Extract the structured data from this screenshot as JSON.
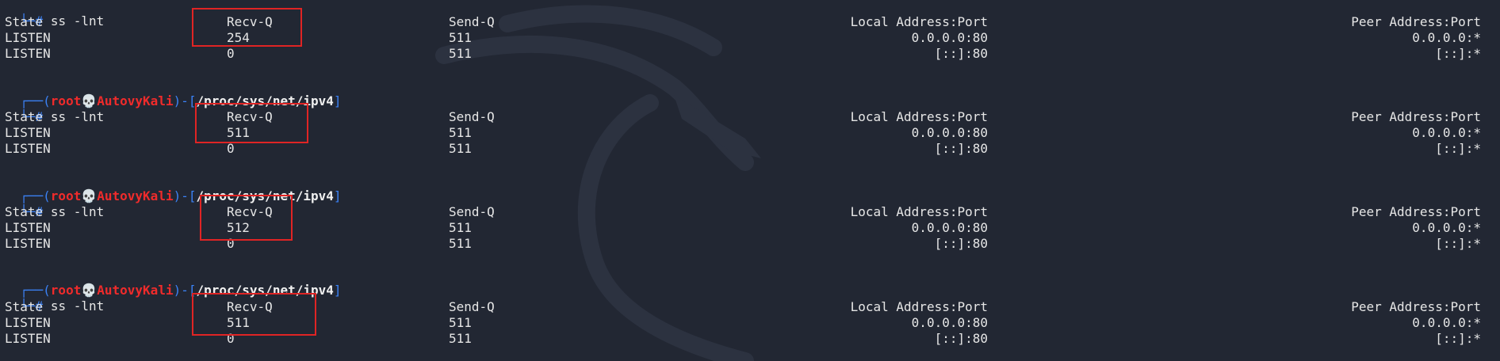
{
  "colors": {
    "background": "#222733",
    "prompt": "#3b82f6",
    "user": "#ef2b2b",
    "highlight": "#e02424"
  },
  "prompt": {
    "open": "┌──(",
    "user": "root",
    "skull": "💀",
    "host": "AutovyKali",
    "mid": ")-[",
    "path": "/proc/sys/net/ipv4",
    "close": "]",
    "hash_prefix": "└─",
    "hash": "#"
  },
  "blocks": [
    {
      "command": "ss -lnt",
      "header": {
        "state": "State",
        "recv": "Recv-Q",
        "send": "Send-Q",
        "local": "Local Address:Port",
        "peer": "Peer Address:Port"
      },
      "rows": [
        {
          "state": "LISTEN",
          "recv": "254",
          "send": "511",
          "local": "0.0.0.0:80",
          "peer": "0.0.0.0:*"
        },
        {
          "state": "LISTEN",
          "recv": "0",
          "send": "511",
          "local": "[::]:80",
          "peer": "[::]:*"
        }
      ]
    },
    {
      "command": "ss -lnt",
      "header": {
        "state": "State",
        "recv": "Recv-Q",
        "send": "Send-Q",
        "local": "Local Address:Port",
        "peer": "Peer Address:Port"
      },
      "rows": [
        {
          "state": "LISTEN",
          "recv": "511",
          "send": "511",
          "local": "0.0.0.0:80",
          "peer": "0.0.0.0:*"
        },
        {
          "state": "LISTEN",
          "recv": "0",
          "send": "511",
          "local": "[::]:80",
          "peer": "[::]:*"
        }
      ]
    },
    {
      "command": "ss -lnt",
      "header": {
        "state": "State",
        "recv": "Recv-Q",
        "send": "Send-Q",
        "local": "Local Address:Port",
        "peer": "Peer Address:Port"
      },
      "rows": [
        {
          "state": "LISTEN",
          "recv": "512",
          "send": "511",
          "local": "0.0.0.0:80",
          "peer": "0.0.0.0:*"
        },
        {
          "state": "LISTEN",
          "recv": "0",
          "send": "511",
          "local": "[::]:80",
          "peer": "[::]:*"
        }
      ]
    },
    {
      "command": "ss -lnt",
      "header": {
        "state": "State",
        "recv": "Recv-Q",
        "send": "Send-Q",
        "local": "Local Address:Port",
        "peer": "Peer Address:Port"
      },
      "rows": [
        {
          "state": "LISTEN",
          "recv": "511",
          "send": "511",
          "local": "0.0.0.0:80",
          "peer": "0.0.0.0:*"
        },
        {
          "state": "LISTEN",
          "recv": "0",
          "send": "511",
          "local": "[::]:80",
          "peer": "[::]:*"
        }
      ]
    }
  ]
}
